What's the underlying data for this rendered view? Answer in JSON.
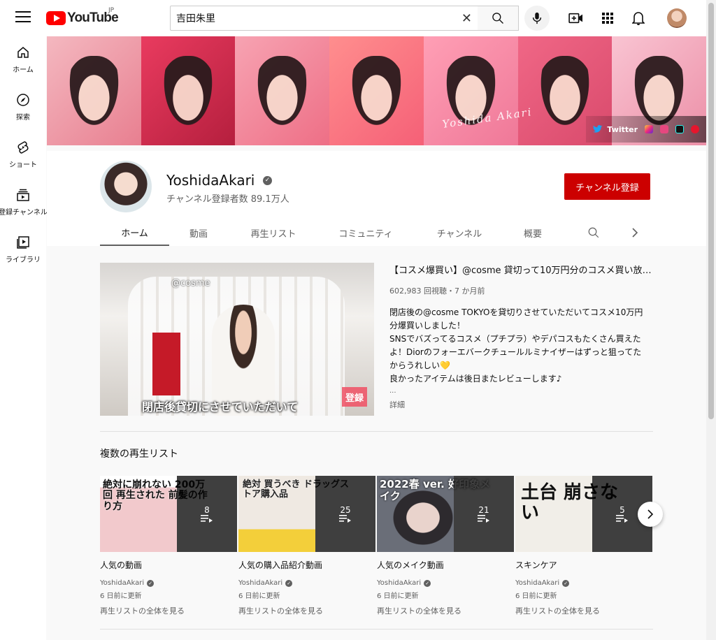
{
  "header": {
    "logo_text": "YouTube",
    "logo_region": "JP",
    "search_value": "吉田朱里"
  },
  "sidebar": {
    "items": [
      {
        "label": "ホーム",
        "icon": "home-icon"
      },
      {
        "label": "探索",
        "icon": "explore-icon"
      },
      {
        "label": "ショート",
        "icon": "shorts-icon"
      },
      {
        "label": "登録チャンネル",
        "icon": "subscriptions-icon"
      },
      {
        "label": "ライブラリ",
        "icon": "library-icon"
      }
    ]
  },
  "banner": {
    "signature": "Yoshida Akari",
    "twitter_label": "Twitter"
  },
  "channel": {
    "name": "YoshidaAkari",
    "verified_mark": "✓",
    "subscribers": "チャンネル登録者数 89.1万人",
    "subscribe_label": "チャンネル登録",
    "tabs": [
      "ホーム",
      "動画",
      "再生リスト",
      "コミュニティ",
      "チャンネル",
      "概要"
    ]
  },
  "featured": {
    "title": "【コスメ爆買い】@cosme 貸切って10万円分のコスメ買い放題…",
    "meta": "602,983 回視聴・7 か月前",
    "description": [
      "閉店後の@cosme TOKYOを貸切りさせていただいてコスメ10万円分爆買いしました！",
      "SNSでバズってるコスメ（プチプラ）やデパコスもたくさん買えたよ！Diorのフォーエバークチュールルミナイザーはずっと狙ってたからうれしい💛",
      "良かったアイテムは後日またレビューします♪"
    ],
    "ellipsis": "...",
    "more_label": "詳細",
    "thumb_caption": "閉店後貸切にさせていただいて",
    "thumb_top_text": "@cosme",
    "thumb_badge": "登録"
  },
  "playlists_section": {
    "title": "複数の再生リスト",
    "items": [
      {
        "title": "人気の動画",
        "count": "8",
        "channel": "YoshidaAkari",
        "updated": "6 日前に更新",
        "view_all": "再生リストの全体を見る",
        "thumb_text": "絶対に崩れない 200万回 再生された 前髪の作り方",
        "thumb_color": "#f2c9cc"
      },
      {
        "title": "人気の購入品紹介動画",
        "count": "25",
        "channel": "YoshidaAkari",
        "updated": "6 日前に更新",
        "view_all": "再生リストの全体を見る",
        "thumb_text": "絶対 買うべき ドラッグストア購入品",
        "thumb_color": "#e8e2da"
      },
      {
        "title": "人気のメイク動画",
        "count": "21",
        "channel": "YoshidaAkari",
        "updated": "6 日前に更新",
        "view_all": "再生リストの全体を見る",
        "thumb_text": "2022春 ver. 好印象メイク",
        "thumb_color": "#6a6e78"
      },
      {
        "title": "スキンケア",
        "count": "5",
        "channel": "YoshidaAkari",
        "updated": "6 日前に更新",
        "view_all": "再生リストの全体を見る",
        "thumb_text": "土台 崩さない",
        "thumb_color": "#f1eee8"
      }
    ]
  }
}
